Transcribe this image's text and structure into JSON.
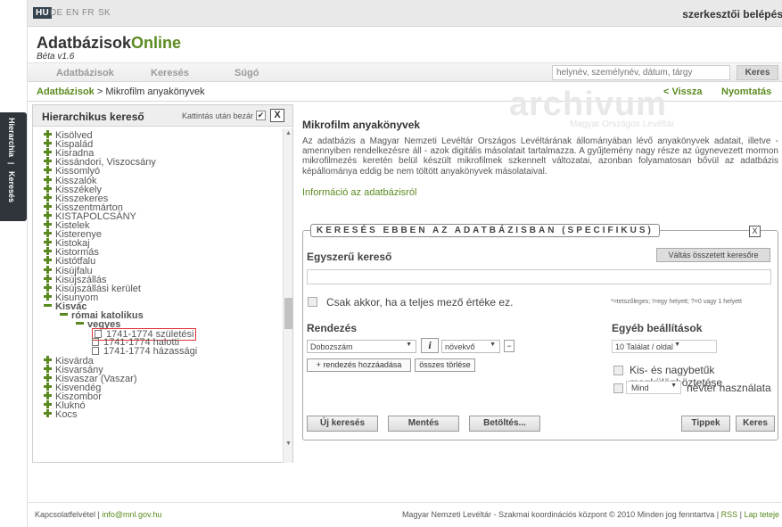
{
  "languages": [
    "HU",
    "DE",
    "EN",
    "FR",
    "SK"
  ],
  "editor_login": "szerkesztői belépés",
  "logo": {
    "part1": "Adatbázisok",
    "part2": "Online"
  },
  "beta": "Béta v1.6",
  "menu": {
    "databases": "Adatbázisok",
    "search": "Keresés",
    "help": "Súgó"
  },
  "search": {
    "placeholder": "helynév, személynév, dátum, tárgy",
    "button": "Keres"
  },
  "breadcrumb": {
    "root": "Adatbázisok",
    "separator": " > ",
    "current": "Mikrofilm anyakönyvek"
  },
  "nav": {
    "back": "< Vissza",
    "print": "Nyomtatás"
  },
  "side_tabs": {
    "hierarchy": "Hierarchia",
    "search": "Keresés"
  },
  "tree_panel": {
    "title": "Hierarchikus kereső",
    "close_after_click": "Kattintás után bezár",
    "checked": "✔",
    "close": "X",
    "items": [
      {
        "label": "Kisölved",
        "type": "plus",
        "level": 0
      },
      {
        "label": "Kispalád",
        "type": "plus",
        "level": 0
      },
      {
        "label": "Kisradna",
        "type": "plus",
        "level": 0
      },
      {
        "label": "Kissándori, Viszocsány",
        "type": "plus",
        "level": 0
      },
      {
        "label": "Kissomlyó",
        "type": "plus",
        "level": 0
      },
      {
        "label": "Kisszalók",
        "type": "plus",
        "level": 0
      },
      {
        "label": "Kisszékely",
        "type": "plus",
        "level": 0
      },
      {
        "label": "Kisszekeres",
        "type": "plus",
        "level": 0
      },
      {
        "label": "Kisszentmárton",
        "type": "plus",
        "level": 0
      },
      {
        "label": "KISTAPOLCSÁNY",
        "type": "plus",
        "level": 0
      },
      {
        "label": "Kistelek",
        "type": "plus",
        "level": 0
      },
      {
        "label": "Kisterenye",
        "type": "plus",
        "level": 0
      },
      {
        "label": "Kistokaj",
        "type": "plus",
        "level": 0
      },
      {
        "label": "Kistormás",
        "type": "plus",
        "level": 0
      },
      {
        "label": "Kistótfalu",
        "type": "plus",
        "level": 0
      },
      {
        "label": "Kisújfalu",
        "type": "plus",
        "level": 0
      },
      {
        "label": "Kisújszállás",
        "type": "plus",
        "level": 0
      },
      {
        "label": "Kisújszállási kerület",
        "type": "plus",
        "level": 0
      },
      {
        "label": "Kisunyom",
        "type": "plus",
        "level": 0
      },
      {
        "label": "Kisvác",
        "type": "minus",
        "level": 0,
        "bold": true
      },
      {
        "label": "római katolikus",
        "type": "minus",
        "level": 1,
        "bold": true
      },
      {
        "label": "vegyes",
        "type": "minus",
        "level": 2,
        "bold": true
      },
      {
        "label": "1741-1774 születési",
        "type": "doc",
        "level": 3,
        "highlight": true
      },
      {
        "label": "1741-1774 halotti",
        "type": "doc",
        "level": 3
      },
      {
        "label": "1741-1774 házassági",
        "type": "doc",
        "level": 3
      },
      {
        "label": "Kisvárda",
        "type": "plus",
        "level": 0
      },
      {
        "label": "Kisvarsány",
        "type": "plus",
        "level": 0
      },
      {
        "label": "Kisvaszar (Vaszar)",
        "type": "plus",
        "level": 0
      },
      {
        "label": "Kisvendég",
        "type": "plus",
        "level": 0
      },
      {
        "label": "Kiszombor",
        "type": "plus",
        "level": 0
      },
      {
        "label": "Kluknó",
        "type": "plus",
        "level": 0
      },
      {
        "label": "Kocs",
        "type": "plus",
        "level": 0
      }
    ]
  },
  "watermark": {
    "brand": "archivum",
    "sub": "Magyar Országos Levéltár"
  },
  "content": {
    "title": "Mikrofilm anyakönyvek",
    "description": "Az adatbázis a Magyar Nemzeti Levéltár Országos Levéltárának állományában lévő anyakönyvek adatait, illetve - amennyiben rendelkezésre áll - azok digitális másolatait tartalmazza. A gyűjtemény nagy része az úgynevezett mormon mikrofilmezés keretén belül készült mikrofilmek szkennelt változatai, azonban folyamatosan bővül az adatbázis képállománya eddig be nem töltött anyakönyvek másolataival.",
    "info_link": "Információ az adatbázisról"
  },
  "specific_search": {
    "legend": "KERESÉS EBBEN AZ ADATBÁZISBAN (SPECIFIKUS)",
    "close": "X",
    "simple_title": "Egyszerű kereső",
    "toggle_button": "Váltás összetett keresőre",
    "exact_label": "Csak akkor, ha a teljes mező értéke ez.",
    "wildcards": "*=tetszőleges; !=egy helyett; ?=0 vagy 1 helyett",
    "sort_title": "Rendezés",
    "sort_field": "Dobozszám",
    "info_button": "i",
    "sort_direction": "növekvő",
    "remove_sort": "−",
    "add_sort": "+ rendezés hozzáadása",
    "clear_sort": "összes törlése",
    "other_title": "Egyéb beállítások",
    "hits_per_page": "10 Találat / oldal",
    "case_label": "Kis- és nagybetűk megkülönböztetése",
    "namespace_value": "Mind",
    "namespace_label": "névtér használata",
    "buttons": {
      "new": "Új keresés",
      "save": "Mentés",
      "load": "Betöltés...",
      "tips": "Tippek",
      "search": "Keres"
    }
  },
  "footer": {
    "contact": "Kapcsolatfelvétel",
    "sep": " | ",
    "email": "info@mnl.gov.hu",
    "copyright": "Magyar Nemzeti Levéltár - Szakmai koordinációs központ © 2010 Minden jog fenntartva",
    "rss": "RSS",
    "top": "Lap teteje"
  },
  "colors": {
    "accent": "#5a8a1f",
    "tab_bg": "#30353b",
    "highlight_border": "#dd3333"
  }
}
